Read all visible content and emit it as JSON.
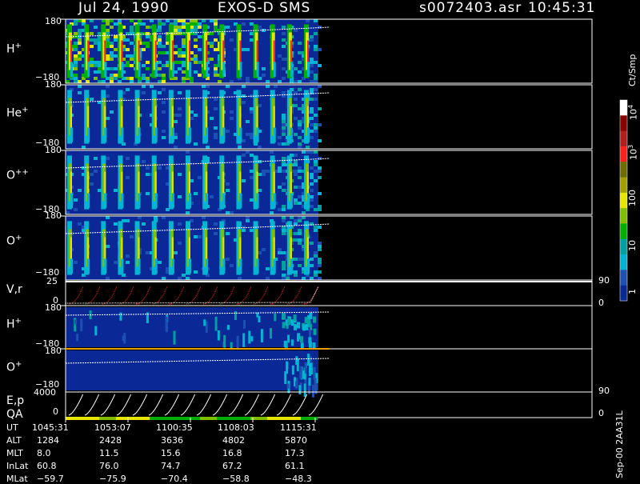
{
  "header": {
    "date": "Jul 24, 1990",
    "instrument": "EXOS-D SMS",
    "file": "s0072403.asr",
    "time": "10:45:31"
  },
  "panels": [
    {
      "label": "H",
      "sup": "+",
      "ytop": "180",
      "ybot": "−180"
    },
    {
      "label": "He",
      "sup": "+",
      "ytop": "180",
      "ybot": "−180"
    },
    {
      "label": "O",
      "sup": "++",
      "ytop": "180",
      "ybot": "−180"
    },
    {
      "label": "O",
      "sup": "+",
      "ytop": "180",
      "ybot": "−180"
    }
  ],
  "vr_panel": {
    "label": "V,r",
    "ytop": "25",
    "ybot": "0",
    "rtop": "90",
    "rbot": "0"
  },
  "lower_panels": [
    {
      "label": "H",
      "sup": "+",
      "ytop": "180",
      "ybot": "−180"
    },
    {
      "label": "O",
      "sup": "+",
      "ytop": "180",
      "ybot": "−180"
    }
  ],
  "ep_panel": {
    "label": "E,p",
    "label2": "QA",
    "ytop": "4000",
    "ybot": "0",
    "rtop": "90",
    "rbot": "0"
  },
  "colorbar": {
    "unit": "Ct/Smp",
    "ticks": [
      "10",
      "10",
      "100",
      "10",
      "1"
    ],
    "exps": [
      "4",
      "3",
      "",
      "",
      ""
    ],
    "colors": [
      "#ffffff",
      "#8b0000",
      "#b41e1e",
      "#ff2020",
      "#6e6e00",
      "#a0a000",
      "#e6e600",
      "#80c000",
      "#00b000",
      "#00a0a0",
      "#00b4d2",
      "#1e50b4",
      "#0a2896"
    ]
  },
  "footer": {
    "ids": "Sep-00  2AA31L",
    "row_labels": [
      "UT",
      "ALT",
      "MLT",
      "InLat",
      "MLat"
    ],
    "columns": [
      [
        "1045:31",
        "1284",
        "8.0",
        "60.8",
        "−59.7"
      ],
      [
        "1053:07",
        "2428",
        "11.5",
        "76.0",
        "−75.9"
      ],
      [
        "1100:35",
        "3636",
        "15.6",
        "74.7",
        "−70.4"
      ],
      [
        "1108:03",
        "4802",
        "16.8",
        "67.2",
        "−58.8"
      ],
      [
        "1115:31",
        "5870",
        "17.3",
        "61.1",
        "−48.3"
      ]
    ]
  },
  "chart_data": {
    "type": "heatmap",
    "title": "Jul 24, 1990   EXOS-D SMS",
    "x_ticks": [
      "1045:31",
      "1053:07",
      "1100:35",
      "1108:03",
      "1115:31"
    ],
    "x_range": [
      "1045:31",
      "1115:31"
    ],
    "ion_panels": [
      "H+",
      "He+",
      "O++",
      "O+"
    ],
    "y_range": [
      -180,
      180
    ],
    "colorbar_ticks": [
      1,
      10,
      100,
      1000,
      10000
    ],
    "colorbar_unit": "Ct/Smp",
    "vr_range": [
      0,
      25
    ],
    "vr_right_range": [
      0,
      90
    ],
    "ep_range": [
      0,
      4000
    ],
    "ep_right_range": [
      0,
      90
    ]
  }
}
